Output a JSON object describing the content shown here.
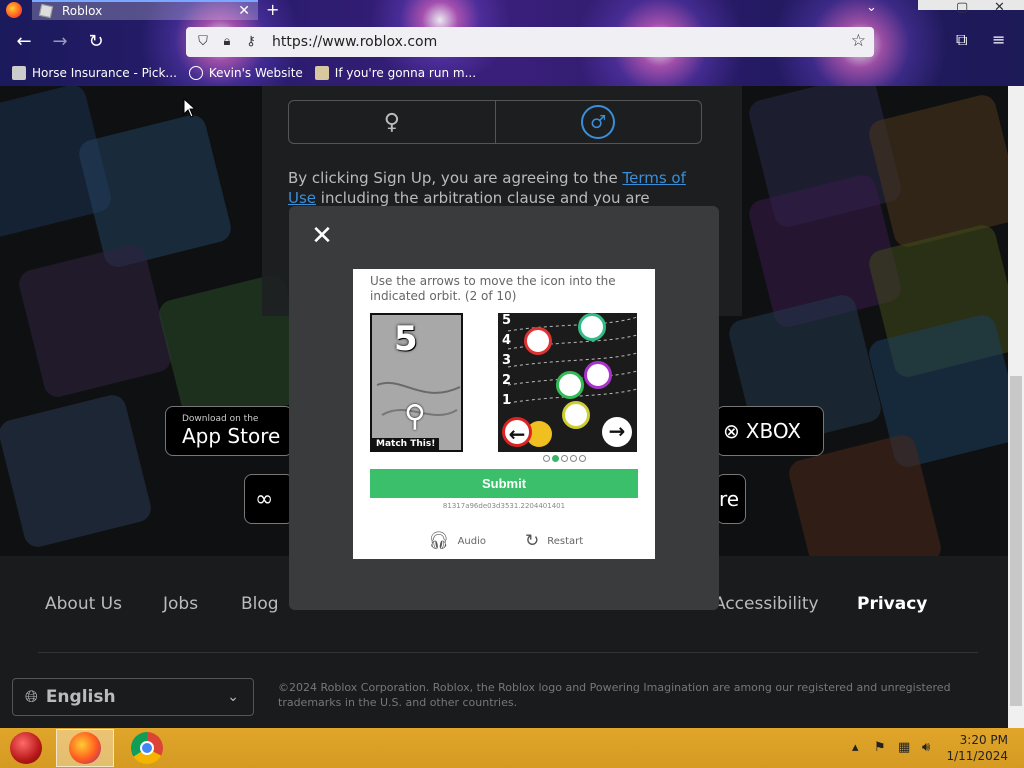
{
  "browser": {
    "tab_title": "Roblox",
    "tab_close": "✕",
    "new_tab": "+",
    "url": "https://www.roblox.com",
    "bookmarks": [
      "Horse Insurance - Pick...",
      "Kevin's Website",
      "If you're gonna run m..."
    ]
  },
  "page": {
    "terms_prefix": "By clicking Sign Up, you are agreeing to the ",
    "terms_link": "Terms of Use",
    "terms_suffix": " including the arbitration clause and you are",
    "app_store_small": "Download on the",
    "app_store_big": "App Store",
    "xbox_label": "XBOX",
    "footer_links": [
      "About Us",
      "Jobs",
      "Blog",
      "Accessibility",
      "Privacy"
    ],
    "language": "English",
    "copyright": "©2024 Roblox Corporation. Roblox, the Roblox logo and Powering Imagination are among our registered and unregistered trademarks in the U.S. and other countries."
  },
  "captcha": {
    "instruction": "Use the arrows to move the icon into the indicated orbit. (2 of 10)",
    "target_number": "5",
    "match_label": "Match This!",
    "orbit_numbers": [
      "5",
      "4",
      "3",
      "2",
      "1"
    ],
    "progress": {
      "current": 2,
      "total": 5
    },
    "submit_label": "Submit",
    "token": "81317a96de03d3531.2204401401",
    "audio_label": "Audio",
    "restart_label": "Restart"
  },
  "taskbar": {
    "time": "3:20 PM",
    "date": "1/11/2024"
  },
  "colors": {
    "accent_blue": "#3a8fd8",
    "submit_green": "#3bbf6b",
    "taskbar": "#d59a22"
  }
}
